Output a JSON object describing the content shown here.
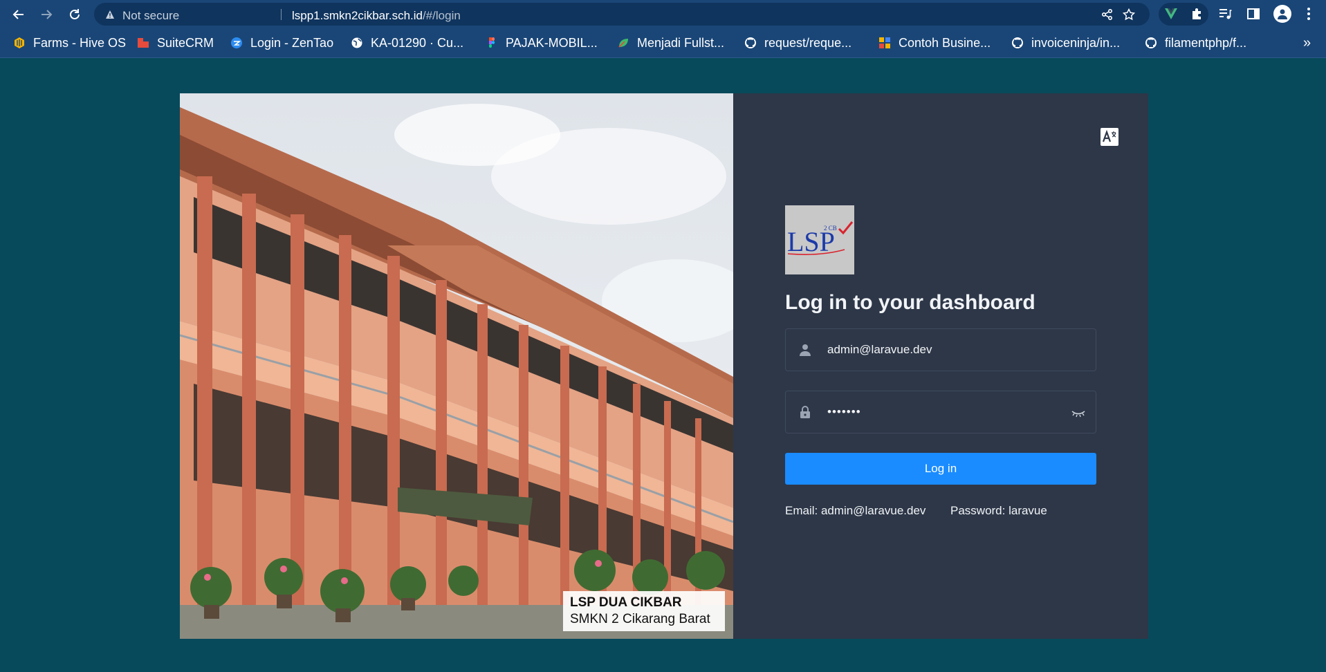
{
  "browser": {
    "security_label": "Not secure",
    "url_host": "lspp1.smkn2cikbar.sch.id",
    "url_path": "/#/login",
    "bookmarks": [
      {
        "label": "Farms - Hive OS",
        "icon": "hiveos-icon",
        "color": "#f6b400"
      },
      {
        "label": "SuiteCRM",
        "icon": "suitecrm-icon",
        "color": "#e64b3c"
      },
      {
        "label": "Login - ZenTao",
        "icon": "zentao-icon",
        "color": "#2d8cf0"
      },
      {
        "label": "KA-01290 · Cu...",
        "icon": "globe-icon",
        "color": "#ffffff"
      },
      {
        "label": "PAJAK-MOBIL...",
        "icon": "figma-icon",
        "color": "#f24e1e"
      },
      {
        "label": "Menjadi Fullst...",
        "icon": "leaf-icon",
        "color": "#3dbb6b"
      },
      {
        "label": "request/reque...",
        "icon": "github-icon",
        "color": "#ffffff"
      },
      {
        "label": "Contoh Busine...",
        "icon": "slides-icon",
        "color": "#f4b400"
      },
      {
        "label": "invoiceninja/in...",
        "icon": "github-icon",
        "color": "#ffffff"
      },
      {
        "label": "filamentphp/f...",
        "icon": "github-icon",
        "color": "#ffffff"
      }
    ],
    "overflow": "»"
  },
  "photo": {
    "caption_title": "LSP DUA CIKBAR",
    "caption_subtitle": "SMKN 2 Cikarang Barat"
  },
  "login": {
    "logo_text": "LSP",
    "logo_mark": "2 CB",
    "heading": "Log in to your dashboard",
    "email_value": "admin@laravue.dev",
    "password_value": "•••••••",
    "submit_label": "Log in",
    "hint_email": "Email: admin@laravue.dev",
    "hint_password": "Password: laravue"
  },
  "colors": {
    "page_bg": "#074a5b",
    "card_bg": "#2d3748",
    "primary": "#1a8cff",
    "chrome": "#1a4677"
  }
}
